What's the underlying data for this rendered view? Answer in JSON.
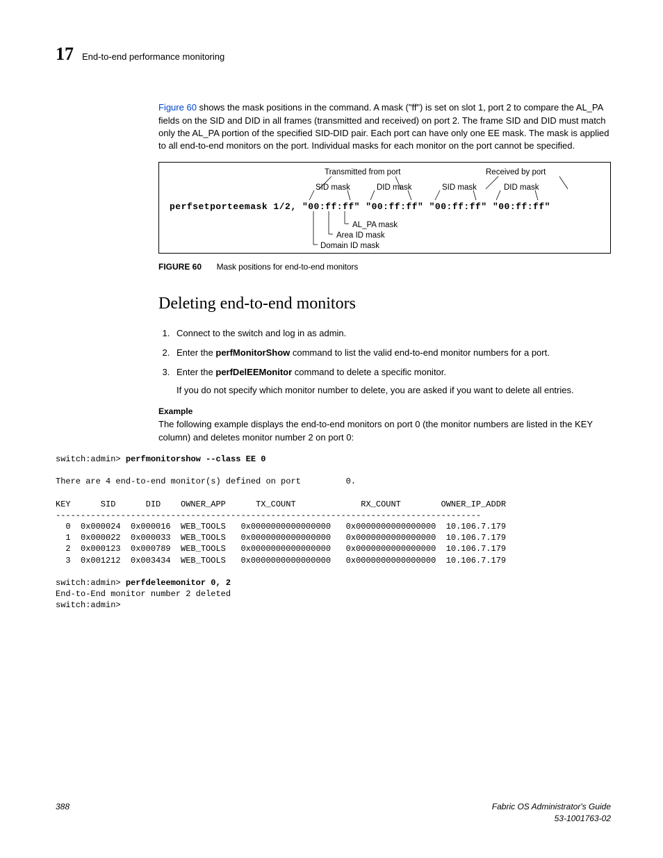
{
  "header": {
    "chapter_number": "17",
    "section": "End-to-end performance monitoring"
  },
  "intro": {
    "link_text": "Figure 60",
    "para_rest": " shows the mask positions in the command. A mask (\"ff\") is set on slot 1, port 2 to compare the AL_PA fields on the SID and DID in all frames (transmitted and received) on port 2. The frame SID and DID must match only the AL_PA portion of the specified SID-DID pair. Each port can have only one EE mask. The mask is applied to all end-to-end monitors on the port. Individual masks for each monitor on the port cannot be specified."
  },
  "figure": {
    "labels": {
      "transmitted": "Transmitted from port",
      "received": "Received by port",
      "sid_mask": "SID mask",
      "did_mask": "DID mask",
      "alpa_mask": "AL_PA mask",
      "area_mask": "Area ID mask",
      "domain_mask": "Domain ID mask"
    },
    "command_prefix": "perfsetporteemask 1/2,",
    "mask_value": "\"00:ff:ff\"",
    "caption_label": "FIGURE 60",
    "caption_text": "Mask positions for end-to-end monitors"
  },
  "section": {
    "heading": "Deleting end-to-end monitors",
    "steps": {
      "s1": "Connect to the switch and log in as admin.",
      "s2_a": "Enter the ",
      "s2_cmd": "perfMonitorShow",
      "s2_b": " command to list the valid end-to-end monitor numbers for a port.",
      "s3_a": "Enter the ",
      "s3_cmd": "perfDelEEMonitor",
      "s3_b": " command to delete a specific monitor.",
      "s3_note": "If you do not specify which monitor number to delete, you are asked if you want to delete all entries."
    },
    "example_label": "Example",
    "example_para": "The following example displays the end-to-end monitors on port 0 (the monitor numbers are listed in the KEY column) and deletes monitor number 2 on port 0:"
  },
  "terminal": {
    "prompt1": "switch:admin> ",
    "cmd1": "perfmonitorshow --class EE 0",
    "line_blank": "",
    "line_defined": "There are 4 end-to-end monitor(s) defined on port         0.",
    "header_row": "KEY      SID      DID    OWNER_APP      TX_COUNT             RX_COUNT        OWNER_IP_ADDR",
    "divider": "-------------------------------------------------------------------------------------",
    "r0": "  0  0x000024  0x000016  WEB_TOOLS   0x0000000000000000   0x0000000000000000  10.106.7.179",
    "r1": "  1  0x000022  0x000033  WEB_TOOLS   0x0000000000000000   0x0000000000000000  10.106.7.179",
    "r2": "  2  0x000123  0x000789  WEB_TOOLS   0x0000000000000000   0x0000000000000000  10.106.7.179",
    "r3": "  3  0x001212  0x003434  WEB_TOOLS   0x0000000000000000   0x0000000000000000  10.106.7.179",
    "prompt2": "switch:admin> ",
    "cmd2": "perfdeleemonitor 0, 2",
    "result": "End-to-End monitor number 2 deleted",
    "prompt3": "switch:admin>"
  },
  "footer": {
    "page_number": "388",
    "doc_title": "Fabric OS Administrator's Guide",
    "doc_id": "53-1001763-02"
  }
}
